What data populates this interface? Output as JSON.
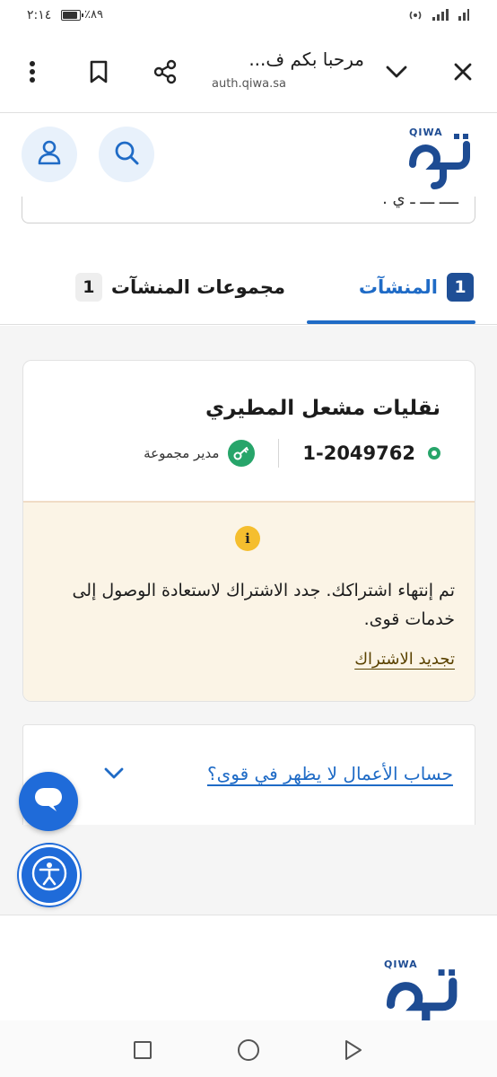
{
  "status_bar": {
    "time": "٢:١٤",
    "battery_percent": "٪٨٩",
    "battery_level": 0.89
  },
  "browser": {
    "page_title": "مرحبا بكم ف...",
    "url_host": "auth.qiwa.sa"
  },
  "brand": {
    "logo_latin": "QIWA",
    "primary_color": "#1e4c93",
    "accent_color": "#1f6bc6"
  },
  "partial_text": "ــــ ـــ ـ ي .",
  "tabs": [
    {
      "label": "المنشآت",
      "count": "1",
      "active": true
    },
    {
      "label": "مجموعات المنشآت",
      "count": "1",
      "active": false
    }
  ],
  "establishment": {
    "name": "نقليات مشعل المطيري",
    "number": "1-2049762",
    "role": "مدير مجموعة",
    "status_color": "#27a56a"
  },
  "alert": {
    "icon": "info-icon",
    "icon_glyph": "i",
    "message": "تم إنتهاء اشتراكك. جدد الاشتراك لاستعادة الوصول إلى خدمات قوى.",
    "action_label": "تجديد الاشتراك"
  },
  "help_question": "حساب الأعمال لا يظهر في قوى؟",
  "floating": {
    "chat_icon": "chat-bubble-icon",
    "accessibility_icon": "accessibility-icon"
  },
  "nav": {
    "icons": [
      "recent-apps-icon",
      "home-icon",
      "back-icon"
    ]
  }
}
